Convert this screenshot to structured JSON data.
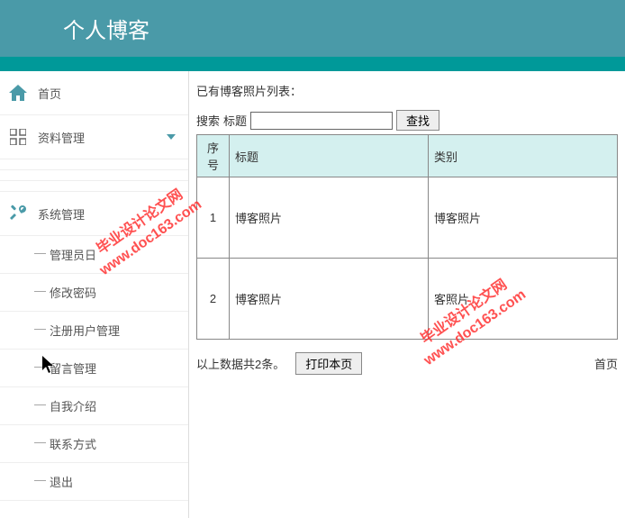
{
  "header": {
    "title": "个人博客"
  },
  "sidebar": {
    "home": "首页",
    "data_mgmt": "资料管理",
    "sys_mgmt": "系统管理",
    "sys_items": [
      "管理员日",
      "修改密码",
      "注册用户管理",
      "留言管理",
      "自我介绍",
      "联系方式",
      "退出"
    ]
  },
  "main": {
    "list_title": "已有博客照片列表：",
    "search_label": "搜索",
    "search_field_label": "标题",
    "search_button": "查找",
    "columns": {
      "num": "序号",
      "title": "标题",
      "category": "类别"
    },
    "rows": [
      {
        "num": "1",
        "title": "博客照片",
        "category": "博客照片"
      },
      {
        "num": "2",
        "title": "博客照片",
        "category": "客照片"
      }
    ],
    "summary": "以上数据共2条。",
    "print_button": "打印本页",
    "pager_first": "首页"
  },
  "watermark": {
    "line1": "毕业设计论文网",
    "line2": "www.doc163.com"
  }
}
